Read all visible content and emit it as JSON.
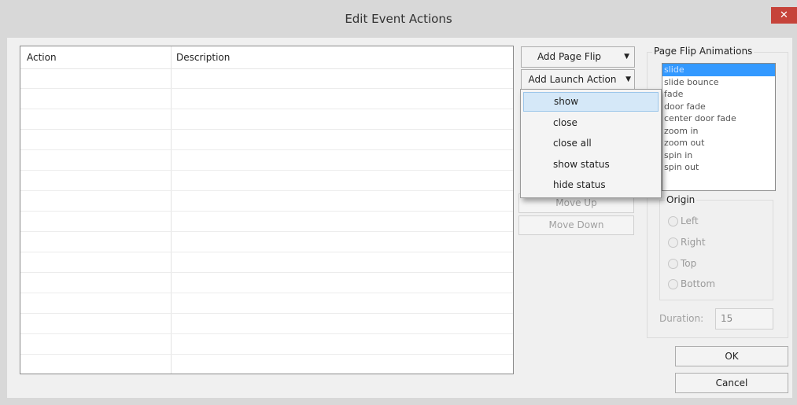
{
  "window": {
    "title": "Edit Event Actions",
    "close_glyph": "✕"
  },
  "table": {
    "columns": [
      "Action",
      "Description"
    ],
    "row_count": 14
  },
  "buttons": {
    "add_page_flip": "Add Page Flip",
    "add_launch_action": "Add Launch Action",
    "move_up": "Move Up",
    "move_down": "Move Down",
    "ok": "OK",
    "cancel": "Cancel"
  },
  "launch_menu": {
    "items": [
      "show",
      "close",
      "close all",
      "show status",
      "hide status"
    ],
    "highlighted": "show"
  },
  "page_flip": {
    "group_label": "Page Flip Animations",
    "animations": [
      "slide",
      "slide bounce",
      "fade",
      "door fade",
      "center door fade",
      "zoom in",
      "zoom out",
      "spin in",
      "spin out"
    ],
    "selected": "slide"
  },
  "origin": {
    "group_label": "Origin",
    "options": [
      "Left",
      "Right",
      "Top",
      "Bottom"
    ]
  },
  "duration": {
    "label": "Duration:",
    "value": "15"
  },
  "colors": {
    "selection": "#3399ff",
    "menu_highlight": "#d5e8f8",
    "close_button": "#c6433a"
  }
}
